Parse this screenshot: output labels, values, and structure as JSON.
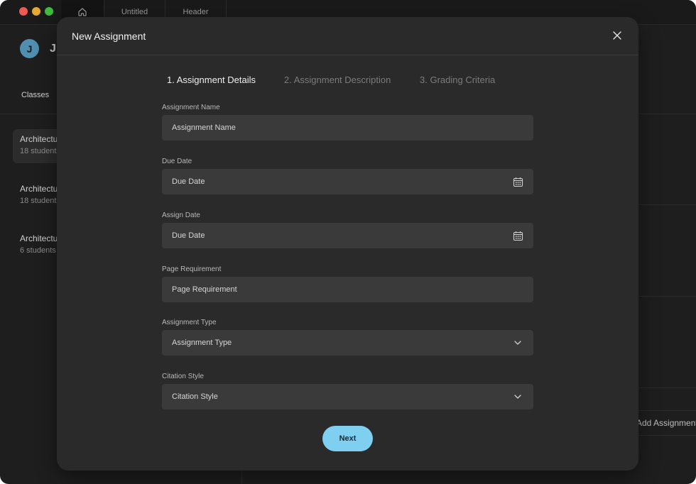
{
  "titlebar": {
    "tabs": [
      {
        "icon": "home-icon",
        "label": ""
      },
      {
        "label": "Untitled"
      },
      {
        "label": "Header"
      }
    ]
  },
  "background": {
    "user_initial": "J",
    "username_visible": "J",
    "nav_label": "Classes",
    "classes": [
      {
        "name": "Architectu",
        "students": "18 students"
      },
      {
        "name": "Architectu",
        "students": "18 students"
      },
      {
        "name": "Architectu",
        "students": "6 students"
      }
    ],
    "add_assignment_label": "Add Assignment"
  },
  "modal": {
    "title": "New Assignment",
    "close_icon": "close-icon",
    "steps": [
      {
        "label": "1. Assignment Details",
        "active": true
      },
      {
        "label": "2. Assignment Description",
        "active": false
      },
      {
        "label": "3. Grading Criteria",
        "active": false
      }
    ],
    "fields": [
      {
        "label": "Assignment Name",
        "placeholder": "Assignment Name",
        "icon": ""
      },
      {
        "label": "Due Date",
        "placeholder": "Due Date",
        "icon": "calendar-icon"
      },
      {
        "label": "Assign Date",
        "placeholder": "Due Date",
        "icon": "calendar-icon"
      },
      {
        "label": "Page Requirement",
        "placeholder": "Page Requirement",
        "icon": ""
      },
      {
        "label": "Assignment Type",
        "placeholder": "Assignment Type",
        "icon": "chevron-down-icon"
      },
      {
        "label": "Citation Style",
        "placeholder": "Citation Style",
        "icon": "chevron-down-icon"
      }
    ],
    "next_label": "Next"
  },
  "colors": {
    "accent": "#7ecff0",
    "modal_bg": "#2a2a2a",
    "field_bg": "#3a3a3a",
    "app_bg": "#1e1e1e"
  }
}
